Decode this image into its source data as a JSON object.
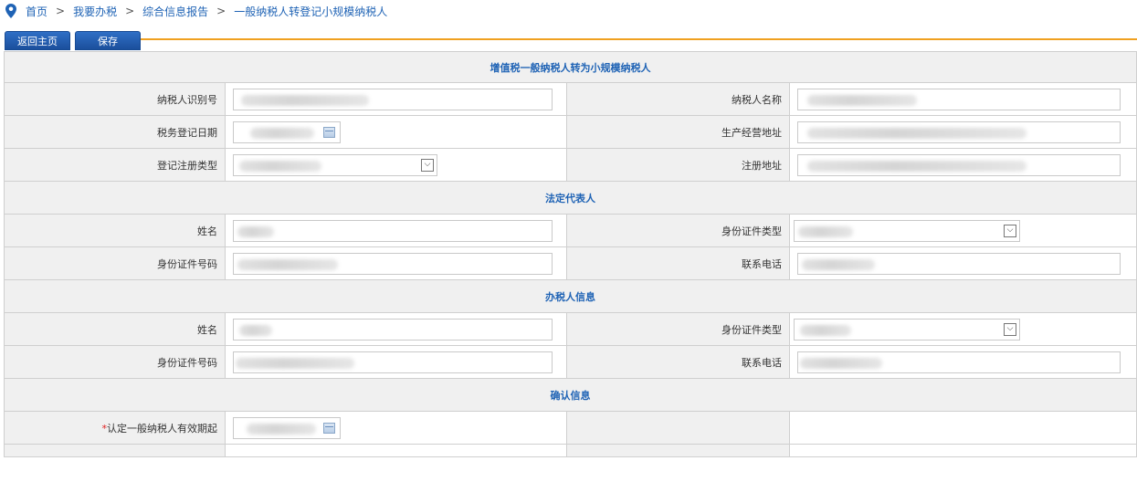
{
  "breadcrumb": {
    "items": [
      "首页",
      "我要办税",
      "综合信息报告",
      "一般纳税人转登记小规模纳税人"
    ],
    "separator": ">"
  },
  "toolbar": {
    "home_label": "返回主页",
    "save_label": "保存"
  },
  "sections": {
    "main_title": "增值税一般纳税人转为小规模纳税人",
    "legal_rep": "法定代表人",
    "tax_agent": "办税人信息",
    "confirm": "确认信息"
  },
  "labels": {
    "taxpayer_id": "纳税人识别号",
    "taxpayer_name": "纳税人名称",
    "reg_date": "税务登记日期",
    "business_address": "生产经营地址",
    "reg_type": "登记注册类型",
    "reg_address": "注册地址",
    "legal_name": "姓名",
    "legal_id_type": "身份证件类型",
    "legal_id_no": "身份证件号码",
    "legal_phone": "联系电话",
    "agent_name": "姓名",
    "agent_id_type": "身份证件类型",
    "agent_id_no": "身份证件号码",
    "agent_phone": "联系电话",
    "effective_start": "认定一般纳税人有效期起",
    "required_mark": "*"
  },
  "colors": {
    "link": "#1f63b5",
    "accent_rule": "#f0a020",
    "button": "#1b4f9c",
    "section_bg": "#f0f0f0",
    "required": "#e02020"
  }
}
